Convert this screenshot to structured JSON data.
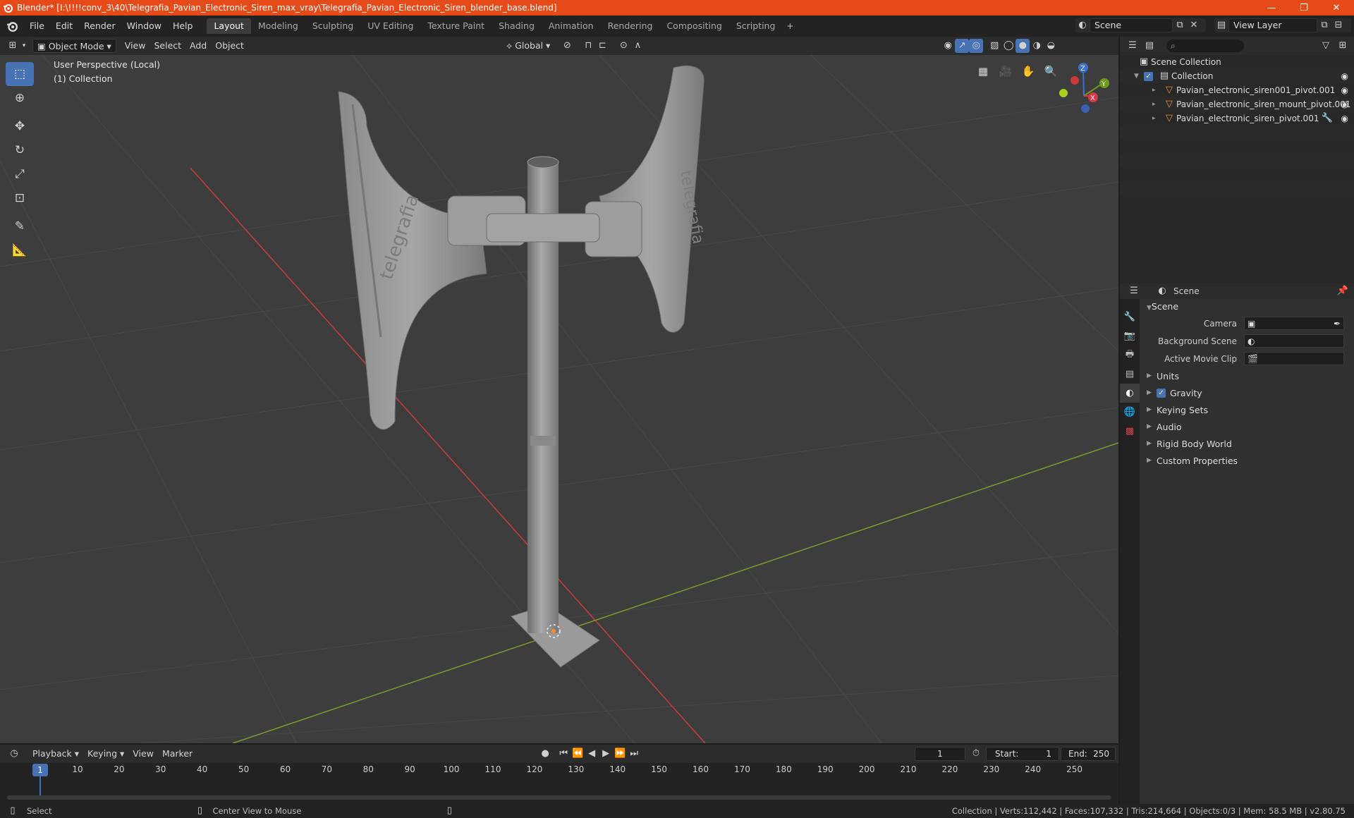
{
  "window": {
    "title": "Blender* [I:\\!!!!conv_3\\40\\Telegrafia_Pavian_Electronic_Siren_max_vray\\Telegrafia_Pavian_Electronic_Siren_blender_base.blend]",
    "minimize": "—",
    "maximize": "❐",
    "close": "✕"
  },
  "menu": {
    "items": [
      "File",
      "Edit",
      "Render",
      "Window",
      "Help"
    ]
  },
  "workspaces": {
    "tabs": [
      "Layout",
      "Modeling",
      "Sculpting",
      "UV Editing",
      "Texture Paint",
      "Shading",
      "Animation",
      "Rendering",
      "Compositing",
      "Scripting"
    ],
    "active": "Layout",
    "add": "+"
  },
  "scene_selector": {
    "value": "Scene"
  },
  "view_layer_selector": {
    "value": "View Layer"
  },
  "viewport_header": {
    "mode": "Object Mode",
    "view": "View",
    "select": "Select",
    "add": "Add",
    "object": "Object",
    "transform_orientation": "Global"
  },
  "viewport": {
    "perspective_label": "User Perspective (Local)",
    "collection_label": "(1) Collection",
    "axis_x": "X",
    "axis_y": "Y",
    "axis_z": "Z",
    "brand_text": "telegrafia"
  },
  "outliner": {
    "root": "Scene Collection",
    "collection": "Collection",
    "objects": [
      "Pavian_electronic_siren001_pivot.001",
      "Pavian_electronic_siren_mount_pivot.001",
      "Pavian_electronic_siren_pivot.001"
    ]
  },
  "properties": {
    "header_title": "Scene",
    "panel_title": "Scene",
    "camera_label": "Camera",
    "background_scene_label": "Background Scene",
    "active_movie_clip_label": "Active Movie Clip",
    "subpanels": [
      "Units",
      "Gravity",
      "Keying Sets",
      "Audio",
      "Rigid Body World",
      "Custom Properties"
    ]
  },
  "timeline": {
    "playback": "Playback",
    "keying": "Keying",
    "view": "View",
    "marker": "Marker",
    "current_frame": "1",
    "start_label": "Start:",
    "start_value": "1",
    "end_label": "End:",
    "end_value": "250",
    "frame_marks": [
      "10",
      "20",
      "30",
      "40",
      "50",
      "60",
      "70",
      "80",
      "90",
      "100",
      "110",
      "120",
      "130",
      "140",
      "150",
      "160",
      "170",
      "180",
      "190",
      "200",
      "210",
      "220",
      "230",
      "240",
      "250"
    ]
  },
  "statusbar": {
    "select": "Select",
    "center_view": "Center View to Mouse",
    "stats": "Collection | Verts:112,442 | Faces:107,332 | Tris:214,664 | Objects:0/3 | Mem: 58.5 MB | v2.80.75"
  },
  "colors": {
    "title_bar": "#e64a19",
    "accent": "#4772b3",
    "viewport_bg": "#3d3d3d",
    "x_axis": "#c83a3a",
    "y_axis": "#7a9a2a"
  }
}
